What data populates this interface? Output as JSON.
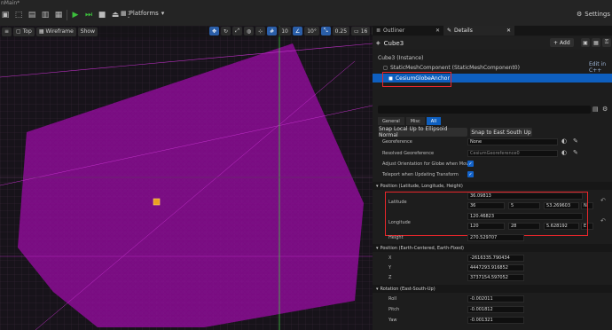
{
  "app": {
    "title": "nMain*"
  },
  "toolbar": {
    "platforms_label": "Platforms",
    "settings_label": "Settings"
  },
  "viewport": {
    "perspective_label": "Top",
    "view_mode_label": "Wireframe",
    "show_label": "Show",
    "grid_snap": "10",
    "rotation_snap": "10°",
    "scale_snap": "0.25",
    "camera_speed": "16"
  },
  "panel": {
    "tabs": [
      {
        "label": "Outliner"
      },
      {
        "label": "Details"
      }
    ],
    "actor_name": "Cube3",
    "add_label": "Add",
    "instance_label": "Cube3 (Instance)",
    "component_label": "StaticMeshComponent (StaticMeshComponent0)",
    "edit_cpp_label": "Edit in C++",
    "selected_component": "CesiumGlobeAnchor",
    "category_tabs": [
      "General",
      "Misc",
      "All"
    ],
    "snap_up_label": "Snap Local Up to Ellipsoid Normal",
    "snap_esu_label": "Snap to East South Up",
    "georeference": {
      "label": "Georeference",
      "value": "None"
    },
    "resolved_georeference": {
      "label": "Resolved Georeference",
      "value": "CesiumGeoreference0"
    },
    "adjust_orientation_label": "Adjust Orientation for Globe when Movi...",
    "teleport_label": "Teleport when Updating Transform",
    "position_section": "Position (Latitude, Longitude, Height)",
    "latitude": {
      "label": "Latitude",
      "decimal": "36.09813",
      "deg": "36",
      "min": "5",
      "sec": "53.269603",
      "dir": "N"
    },
    "longitude": {
      "label": "Longitude",
      "decimal": "120.46823",
      "deg": "120",
      "min": "28",
      "sec": "5.628192",
      "dir": "E"
    },
    "height": {
      "label": "Height",
      "value": "270.529707"
    },
    "ecef_section": "Position (Earth-Centered, Earth-Fixed)",
    "x": {
      "label": "X",
      "value": "-2616335.790434"
    },
    "y": {
      "label": "Y",
      "value": "4447293.916852"
    },
    "z": {
      "label": "Z",
      "value": "3737154.597052"
    },
    "rotation_section": "Rotation (East-South-Up)",
    "roll": {
      "label": "Roll",
      "value": "-0.002011"
    },
    "pitch": {
      "label": "Pitch",
      "value": "-0.001812"
    },
    "yaw": {
      "label": "Yaw",
      "value": "-0.001321"
    }
  },
  "colors": {
    "mesh": "#a010a8",
    "selection": "#0e5fbf",
    "highlight": "#e8262b"
  }
}
